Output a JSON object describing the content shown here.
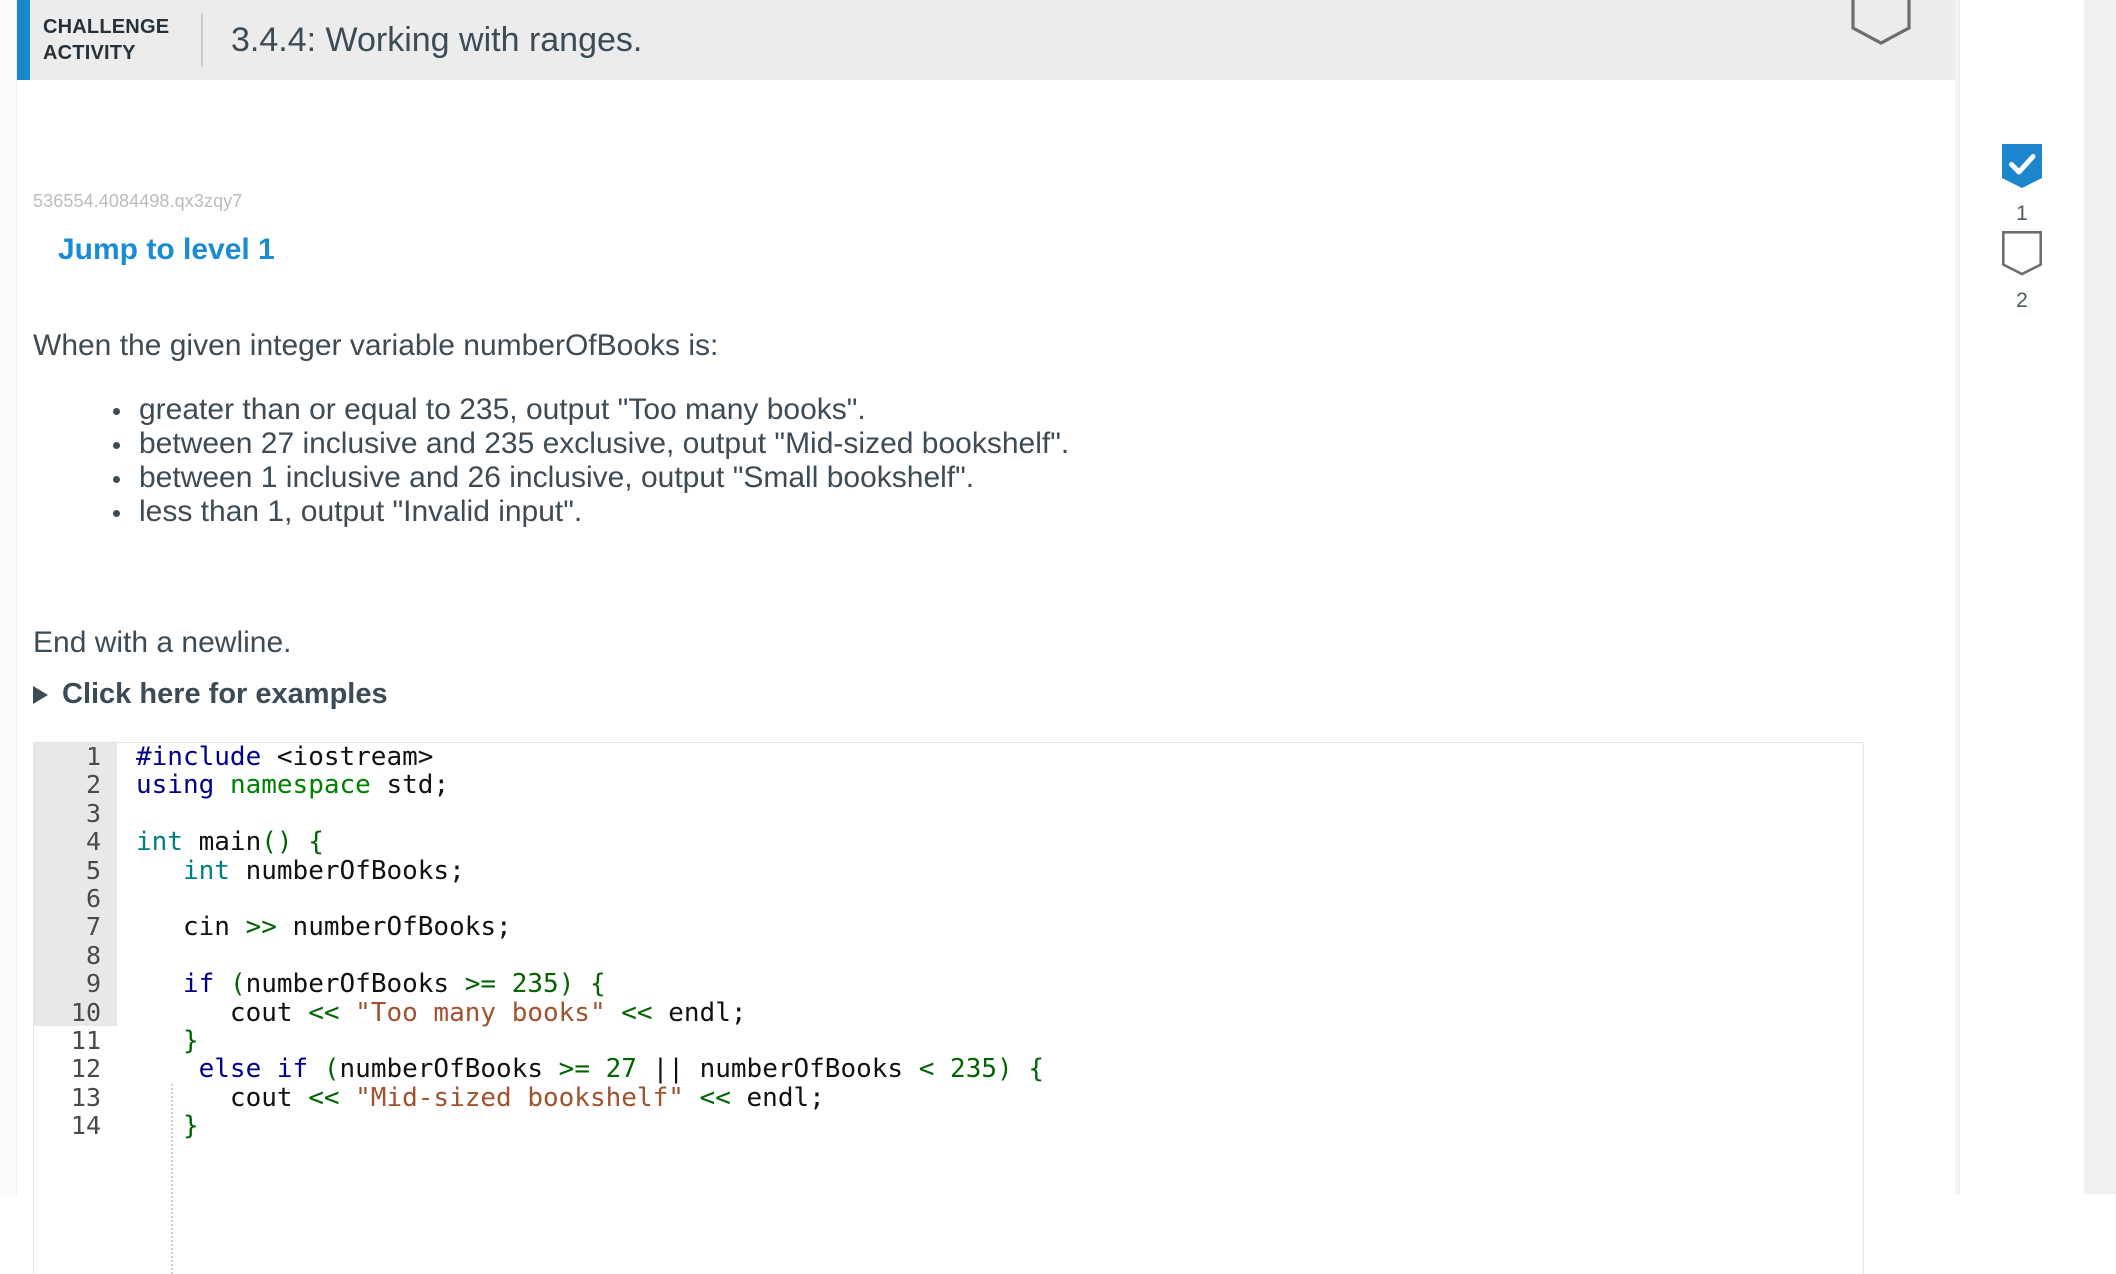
{
  "header": {
    "kicker": "CHALLENGE ACTIVITY",
    "kicker_line1": "CHALLENGE",
    "kicker_line2": "ACTIVITY",
    "title": "3.4.4: Working with ranges.",
    "accent_color": "#1b87cd",
    "background": "#ececec",
    "flag_icon": "bookmark-outline-icon"
  },
  "activity": {
    "reference_id": "536554.4084498.qx3zqy7",
    "jump_link": "Jump to level 1",
    "prompt": "When the given integer variable numberOfBooks is:",
    "requirements": [
      "greater than or equal to 235, output \"Too many books\".",
      "between 27 inclusive and 235 exclusive, output \"Mid-sized bookshelf\".",
      "between 1 inclusive and 26 inclusive, output \"Small bookshelf\".",
      "less than 1, output \"Invalid input\"."
    ],
    "end_note": "End with a newline.",
    "examples_toggle": "Click here for examples",
    "examples_expanded": false
  },
  "progress_rail": {
    "steps": [
      {
        "label": "1",
        "state": "complete",
        "icon": "bookmark-check-icon",
        "color": "#1b86cc"
      },
      {
        "label": "2",
        "state": "incomplete",
        "icon": "bookmark-outline-icon",
        "color": "#6e6e6e"
      }
    ]
  },
  "editor": {
    "language": "cpp",
    "highlighted_gutter_through_line": 7,
    "lines": [
      {
        "n": "1",
        "tokens": [
          {
            "t": "#include",
            "c": "k-pre"
          },
          {
            "t": " ",
            "c": "k-plain"
          },
          {
            "t": "<iostream>",
            "c": "k-plain"
          }
        ]
      },
      {
        "n": "2",
        "tokens": [
          {
            "t": "using",
            "c": "k-pre"
          },
          {
            "t": " ",
            "c": "k-plain"
          },
          {
            "t": "namespace",
            "c": "k-ns"
          },
          {
            "t": " std;",
            "c": "k-plain"
          }
        ]
      },
      {
        "n": "3",
        "tokens": []
      },
      {
        "n": "4",
        "tokens": [
          {
            "t": "int",
            "c": "k-type"
          },
          {
            "t": " main",
            "c": "k-plain"
          },
          {
            "t": "()",
            "c": "k-op"
          },
          {
            "t": " ",
            "c": "k-plain"
          },
          {
            "t": "{",
            "c": "k-op"
          }
        ]
      },
      {
        "n": "5",
        "tokens": [
          {
            "t": "   ",
            "c": "k-plain"
          },
          {
            "t": "int",
            "c": "k-type"
          },
          {
            "t": " numberOfBooks;",
            "c": "k-plain"
          }
        ]
      },
      {
        "n": "6",
        "tokens": []
      },
      {
        "n": "7",
        "tokens": [
          {
            "t": "   cin ",
            "c": "k-plain"
          },
          {
            "t": ">>",
            "c": "k-op"
          },
          {
            "t": " numberOfBooks;",
            "c": "k-plain"
          }
        ]
      },
      {
        "n": "8",
        "tokens": []
      },
      {
        "n": "9",
        "tokens": [
          {
            "t": "   ",
            "c": "k-plain"
          },
          {
            "t": "if",
            "c": "k-pre"
          },
          {
            "t": " ",
            "c": "k-plain"
          },
          {
            "t": "(",
            "c": "k-op"
          },
          {
            "t": "numberOfBooks ",
            "c": "k-plain"
          },
          {
            "t": ">=",
            "c": "k-op"
          },
          {
            "t": " ",
            "c": "k-plain"
          },
          {
            "t": "235",
            "c": "k-num"
          },
          {
            "t": ")",
            "c": "k-op"
          },
          {
            "t": " ",
            "c": "k-plain"
          },
          {
            "t": "{",
            "c": "k-op"
          }
        ]
      },
      {
        "n": "10",
        "tokens": [
          {
            "t": "      cout ",
            "c": "k-plain"
          },
          {
            "t": "<<",
            "c": "k-op"
          },
          {
            "t": " ",
            "c": "k-plain"
          },
          {
            "t": "\"Too many books\"",
            "c": "k-str"
          },
          {
            "t": " ",
            "c": "k-plain"
          },
          {
            "t": "<<",
            "c": "k-op"
          },
          {
            "t": " endl;",
            "c": "k-plain"
          }
        ]
      },
      {
        "n": "11",
        "tokens": [
          {
            "t": "   ",
            "c": "k-plain"
          },
          {
            "t": "}",
            "c": "k-op"
          }
        ]
      },
      {
        "n": "12",
        "tokens": [
          {
            "t": "    ",
            "c": "k-plain"
          },
          {
            "t": "else if",
            "c": "k-pre"
          },
          {
            "t": " ",
            "c": "k-plain"
          },
          {
            "t": "(",
            "c": "k-op"
          },
          {
            "t": "numberOfBooks ",
            "c": "k-plain"
          },
          {
            "t": ">=",
            "c": "k-op"
          },
          {
            "t": " ",
            "c": "k-plain"
          },
          {
            "t": "27",
            "c": "k-num"
          },
          {
            "t": " || ",
            "c": "k-plain"
          },
          {
            "t": "numberOfBooks ",
            "c": "k-plain"
          },
          {
            "t": "<",
            "c": "k-op"
          },
          {
            "t": " ",
            "c": "k-plain"
          },
          {
            "t": "235",
            "c": "k-num"
          },
          {
            "t": ")",
            "c": "k-op"
          },
          {
            "t": " ",
            "c": "k-plain"
          },
          {
            "t": "{",
            "c": "k-op"
          }
        ]
      },
      {
        "n": "13",
        "tokens": [
          {
            "t": "      cout ",
            "c": "k-plain"
          },
          {
            "t": "<<",
            "c": "k-op"
          },
          {
            "t": " ",
            "c": "k-plain"
          },
          {
            "t": "\"Mid-sized bookshelf\"",
            "c": "k-str"
          },
          {
            "t": " ",
            "c": "k-plain"
          },
          {
            "t": "<<",
            "c": "k-op"
          },
          {
            "t": " endl;",
            "c": "k-plain"
          }
        ]
      },
      {
        "n": "14",
        "tokens": [
          {
            "t": "   ",
            "c": "k-plain"
          },
          {
            "t": "}",
            "c": "k-op"
          }
        ]
      }
    ]
  }
}
